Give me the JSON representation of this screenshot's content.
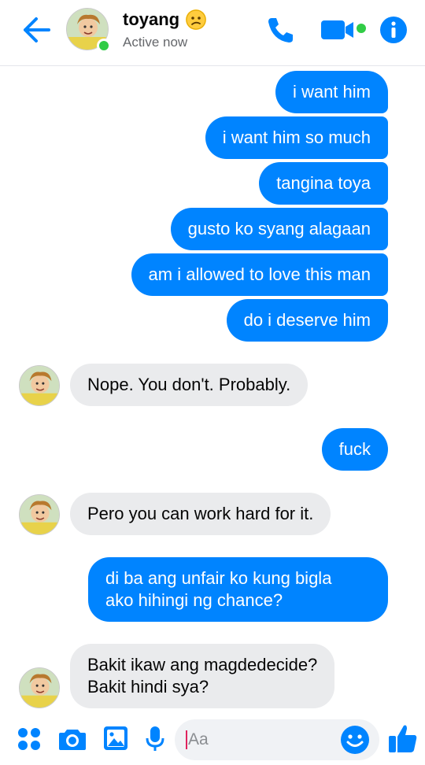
{
  "header": {
    "contact_name": "toyang",
    "status": "Active now"
  },
  "icons": {
    "back": "arrow-left-icon",
    "call": "phone-icon",
    "video": "video-camera-icon",
    "info": "info-icon",
    "menu": "four-dots-icon",
    "camera": "camera-icon",
    "gallery": "image-icon",
    "mic": "microphone-icon",
    "emoji": "smiley-icon",
    "like": "thumbs-up-icon"
  },
  "colors": {
    "accent": "#0084ff",
    "incoming_bubble": "#eaebed",
    "online": "#31cc46"
  },
  "messages": [
    {
      "side": "out",
      "text": "i want him"
    },
    {
      "side": "out",
      "text": "i want him so much"
    },
    {
      "side": "out",
      "text": "tangina toya"
    },
    {
      "side": "out",
      "text": "gusto ko syang alagaan"
    },
    {
      "side": "out",
      "text": "am i allowed to love this man"
    },
    {
      "side": "out",
      "text": "do i deserve him"
    },
    {
      "side": "in",
      "text": "Nope. You don't. Probably."
    },
    {
      "side": "out",
      "text": "fuck"
    },
    {
      "side": "in",
      "text": "Pero you can work hard for it."
    },
    {
      "side": "out",
      "line1": "di ba ang unfair ko kung bigla",
      "line2": "ako hihingi ng chance?"
    },
    {
      "side": "in",
      "line1": "Bakit ikaw ang magdedecide?",
      "line2": "Bakit hindi sya?"
    }
  ],
  "composer": {
    "placeholder": "Aa"
  }
}
